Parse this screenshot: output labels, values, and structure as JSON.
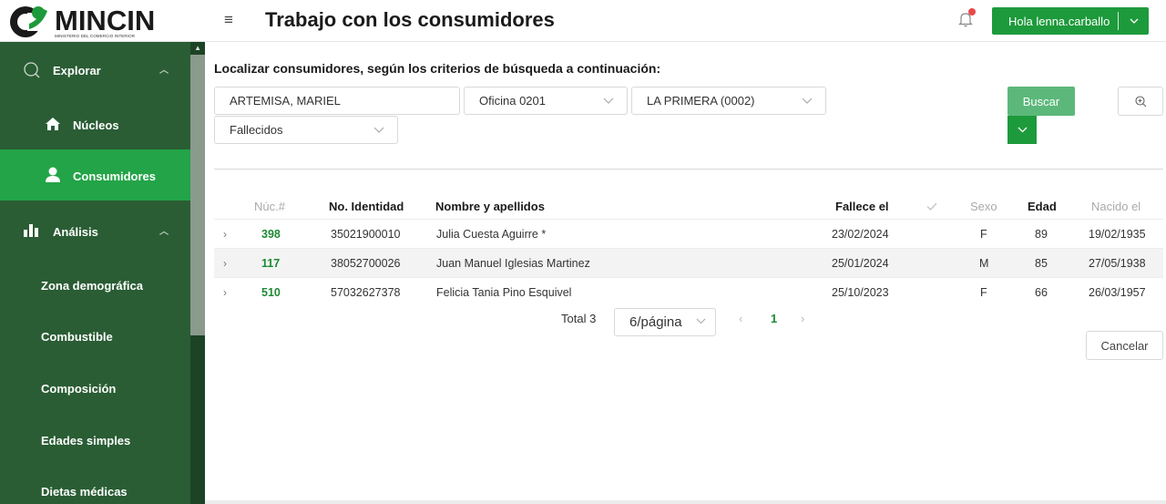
{
  "header": {
    "logo_text": "MINCIN",
    "logo_subtitle": "MINISTERIO DEL COMERCIO INTERIOR",
    "menu_icon": "hamburger-icon",
    "title": "Trabajo con los consumidores",
    "notification_icon": "bell-icon",
    "user_greeting": "Hola lenna.carballo",
    "user_chevron": "⌵"
  },
  "sidebar": {
    "items": [
      {
        "label": "Explorar",
        "icon": "search-icon"
      },
      {
        "label": "Núcleos",
        "icon": "home-icon"
      },
      {
        "label": "Consumidores",
        "icon": "user-icon"
      },
      {
        "label": "Análisis",
        "icon": "bar-chart-icon"
      },
      {
        "label": "Zona demográfica"
      },
      {
        "label": "Combustible"
      },
      {
        "label": "Composición"
      },
      {
        "label": "Edades simples"
      },
      {
        "label": "Dietas médicas"
      }
    ]
  },
  "search": {
    "title": "Localizar consumidores, según los criterios de búsqueda a continuación:",
    "location_value": "ARTEMISA, MARIEL",
    "office_value": "Oficina 0201",
    "bodega_value": "LA PRIMERA (0002)",
    "status_value": "Fallecidos",
    "search_button": "Buscar",
    "more_icon": "chevron-down-icon",
    "zoom_icon": "zoom-in-icon"
  },
  "table": {
    "headers": {
      "nucleo": "Núc.#",
      "identidad": "No. Identidad",
      "nombre": "Nombre y apellidos",
      "fallece": "Fallece el",
      "sexo": "Sexo",
      "edad": "Edad",
      "nacido": "Nacido el"
    },
    "rows": [
      {
        "nucleo": "398",
        "identidad": "35021900010",
        "nombre": "Julia Cuesta Aguirre *",
        "fallece": "23/02/2024",
        "sexo": "F",
        "edad": "89",
        "nacido": "19/02/1935"
      },
      {
        "nucleo": "117",
        "identidad": "38052700026",
        "nombre": "Juan Manuel Iglesias Martinez",
        "fallece": "25/01/2024",
        "sexo": "M",
        "edad": "85",
        "nacido": "27/05/1938"
      },
      {
        "nucleo": "510",
        "identidad": "57032627378",
        "nombre": "Felicia Tania Pino Esquivel",
        "fallece": "25/10/2023",
        "sexo": "F",
        "edad": "66",
        "nacido": "26/03/1957"
      }
    ]
  },
  "pagination": {
    "total": "Total 3",
    "page_size": "6/página",
    "current_page": "1"
  },
  "actions": {
    "cancel": "Cancelar"
  },
  "colors": {
    "brand_green": "#1d9a3b",
    "sidebar_bg": "#2a5d34",
    "sidebar_active": "#23a448"
  }
}
